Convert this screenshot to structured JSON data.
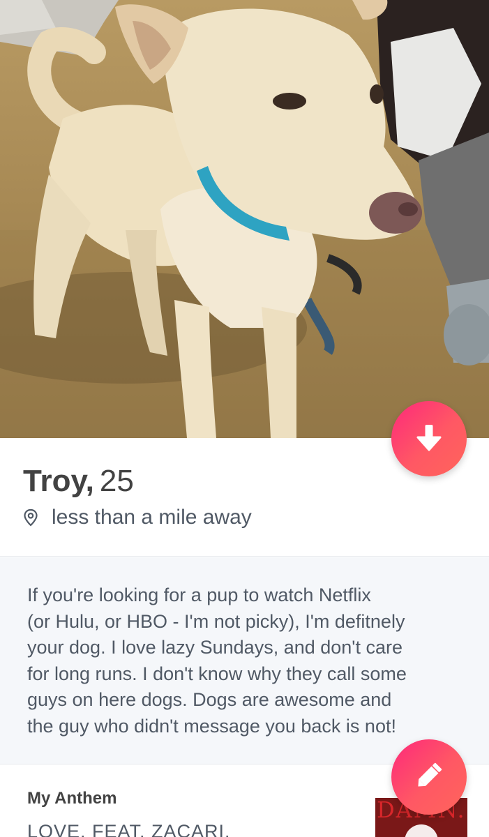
{
  "profile": {
    "name": "Troy,",
    "age": "25",
    "distance": "less than a mile away",
    "bio_lines": [
      "If you're looking for a pup to watch Netflix",
      "(or Hulu, or HBO - I'm not picky), I'm defitnely",
      "your dog. I love lazy Sundays, and don't care",
      "for long runs. I don't know why they call some",
      "guys on here dogs. Dogs are awesome and",
      "the guy who didn't message you back is not!"
    ]
  },
  "anthem": {
    "title": "My Anthem",
    "song": "LOVE. FEAT. ZACARI.",
    "album_text": "DAMN."
  },
  "icons": {
    "collapse": "arrow-down-icon",
    "edit": "pencil-icon",
    "location": "location-pin-icon",
    "play": "play-icon"
  },
  "colors": {
    "accent_start": "#fd297b",
    "accent_end": "#ff655b",
    "text_primary": "#424242",
    "text_secondary": "#505965",
    "bio_background": "#f5f7fa"
  }
}
